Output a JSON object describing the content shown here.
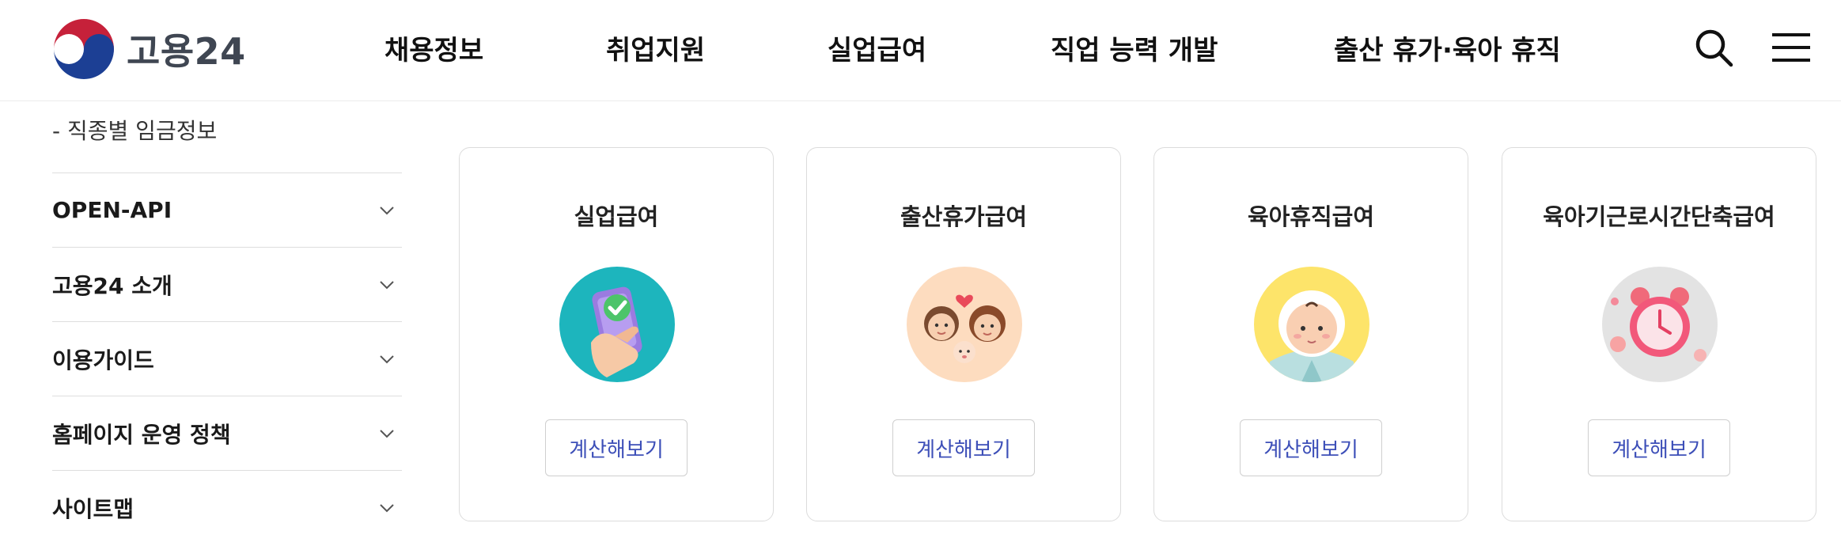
{
  "header": {
    "logo_text": "고용24",
    "nav": [
      "채용정보",
      "취업지원",
      "실업급여",
      "직업 능력 개발",
      "출산 휴가·육아 휴직"
    ],
    "search_icon": "search-icon",
    "menu_icon": "hamburger-menu-icon"
  },
  "sidebar": {
    "sub_link": "- 직종별 임금정보",
    "items": [
      {
        "label": "OPEN-API"
      },
      {
        "label": "고용24 소개"
      },
      {
        "label": "이용가이드"
      },
      {
        "label": "홈페이지 운영 정책"
      },
      {
        "label": "사이트맵"
      }
    ]
  },
  "cards": [
    {
      "title": "실업급여",
      "button": "계산해보기",
      "icon": "phone-check-icon",
      "bg": "#1db5bd"
    },
    {
      "title": "출산휴가급여",
      "button": "계산해보기",
      "icon": "family-icon",
      "bg": "#fddcbf"
    },
    {
      "title": "육아휴직급여",
      "button": "계산해보기",
      "icon": "baby-icon",
      "bg": "#fde46a"
    },
    {
      "title": "육아기근로시간단축급여",
      "button": "계산해보기",
      "icon": "alarm-clock-icon",
      "bg": "#e3e3e3"
    }
  ],
  "colors": {
    "link_blue": "#3d4fb8",
    "logo_red": "#c6213a",
    "logo_blue": "#1c3f94"
  }
}
